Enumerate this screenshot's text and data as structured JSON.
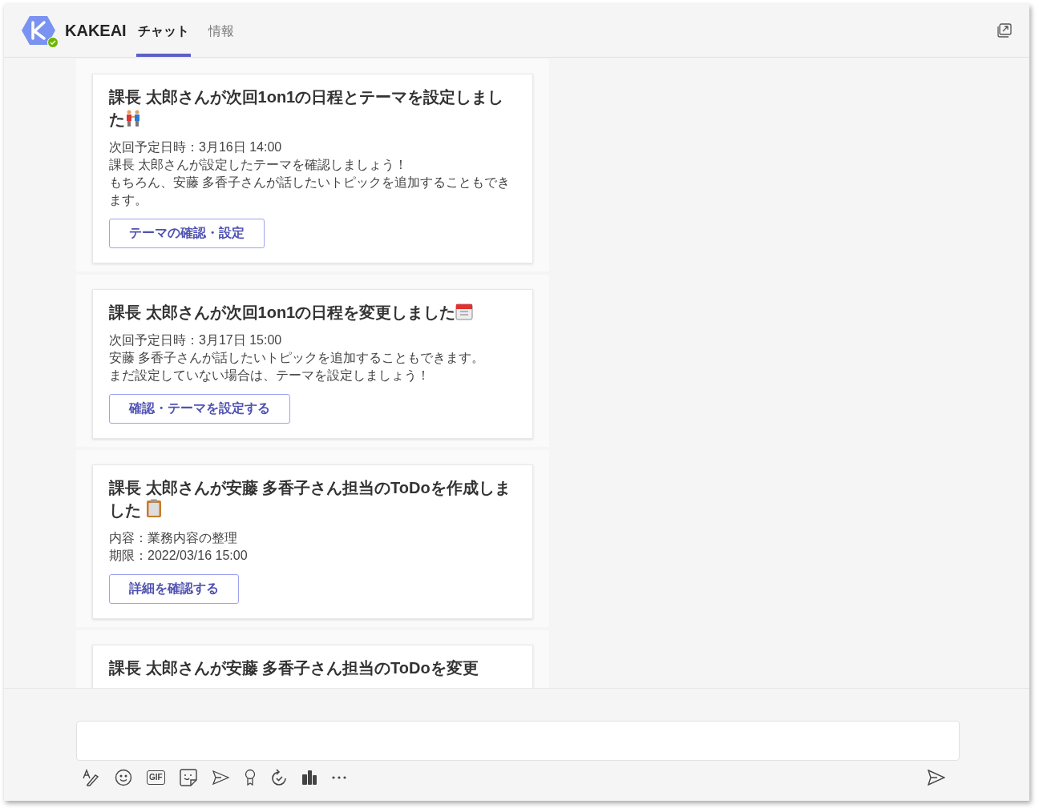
{
  "header": {
    "app_name": "KAKEAI",
    "tabs": [
      {
        "label": "チャット",
        "selected": true
      },
      {
        "label": "情報",
        "selected": false
      }
    ]
  },
  "messages": [
    {
      "title": "課長 太郎さんが次回1on1の日程とテーマを設定しました",
      "kind": "people",
      "lines": [
        "次回予定日時：3月16日 14:00",
        "課長 太郎さんが設定したテーマを確認しましょう！",
        "もちろん、安藤 多香子さんが話したいトピックを追加することもできます。"
      ],
      "button": "テーマの確認・設定"
    },
    {
      "title": "課長 太郎さんが次回1on1の日程を変更しました",
      "kind": "calendar",
      "lines": [
        "次回予定日時：3月17日 15:00",
        "安藤 多香子さんが話したいトピックを追加することもできます。",
        "まだ設定していない場合は、テーマを設定しましょう！"
      ],
      "button": "確認・テーマを設定する"
    },
    {
      "title": "課長 太郎さんが安藤 多香子さん担当のToDoを作成しました",
      "kind": "clipboard",
      "lines": [
        "内容：業務内容の整理",
        "期限：2022/03/16 15:00"
      ],
      "button": "詳細を確認する"
    },
    {
      "title": "課長 太郎さんが安藤 多香子さん担当のToDoを変更",
      "kind": "plain"
    }
  ],
  "toolbar": [
    {
      "kind": "format"
    },
    {
      "kind": "emoji"
    },
    {
      "kind": "gif",
      "label": "GIF"
    },
    {
      "kind": "sticker"
    },
    {
      "kind": "praise"
    },
    {
      "kind": "badge"
    },
    {
      "kind": "loop"
    },
    {
      "kind": "apps"
    },
    {
      "kind": "more"
    }
  ]
}
